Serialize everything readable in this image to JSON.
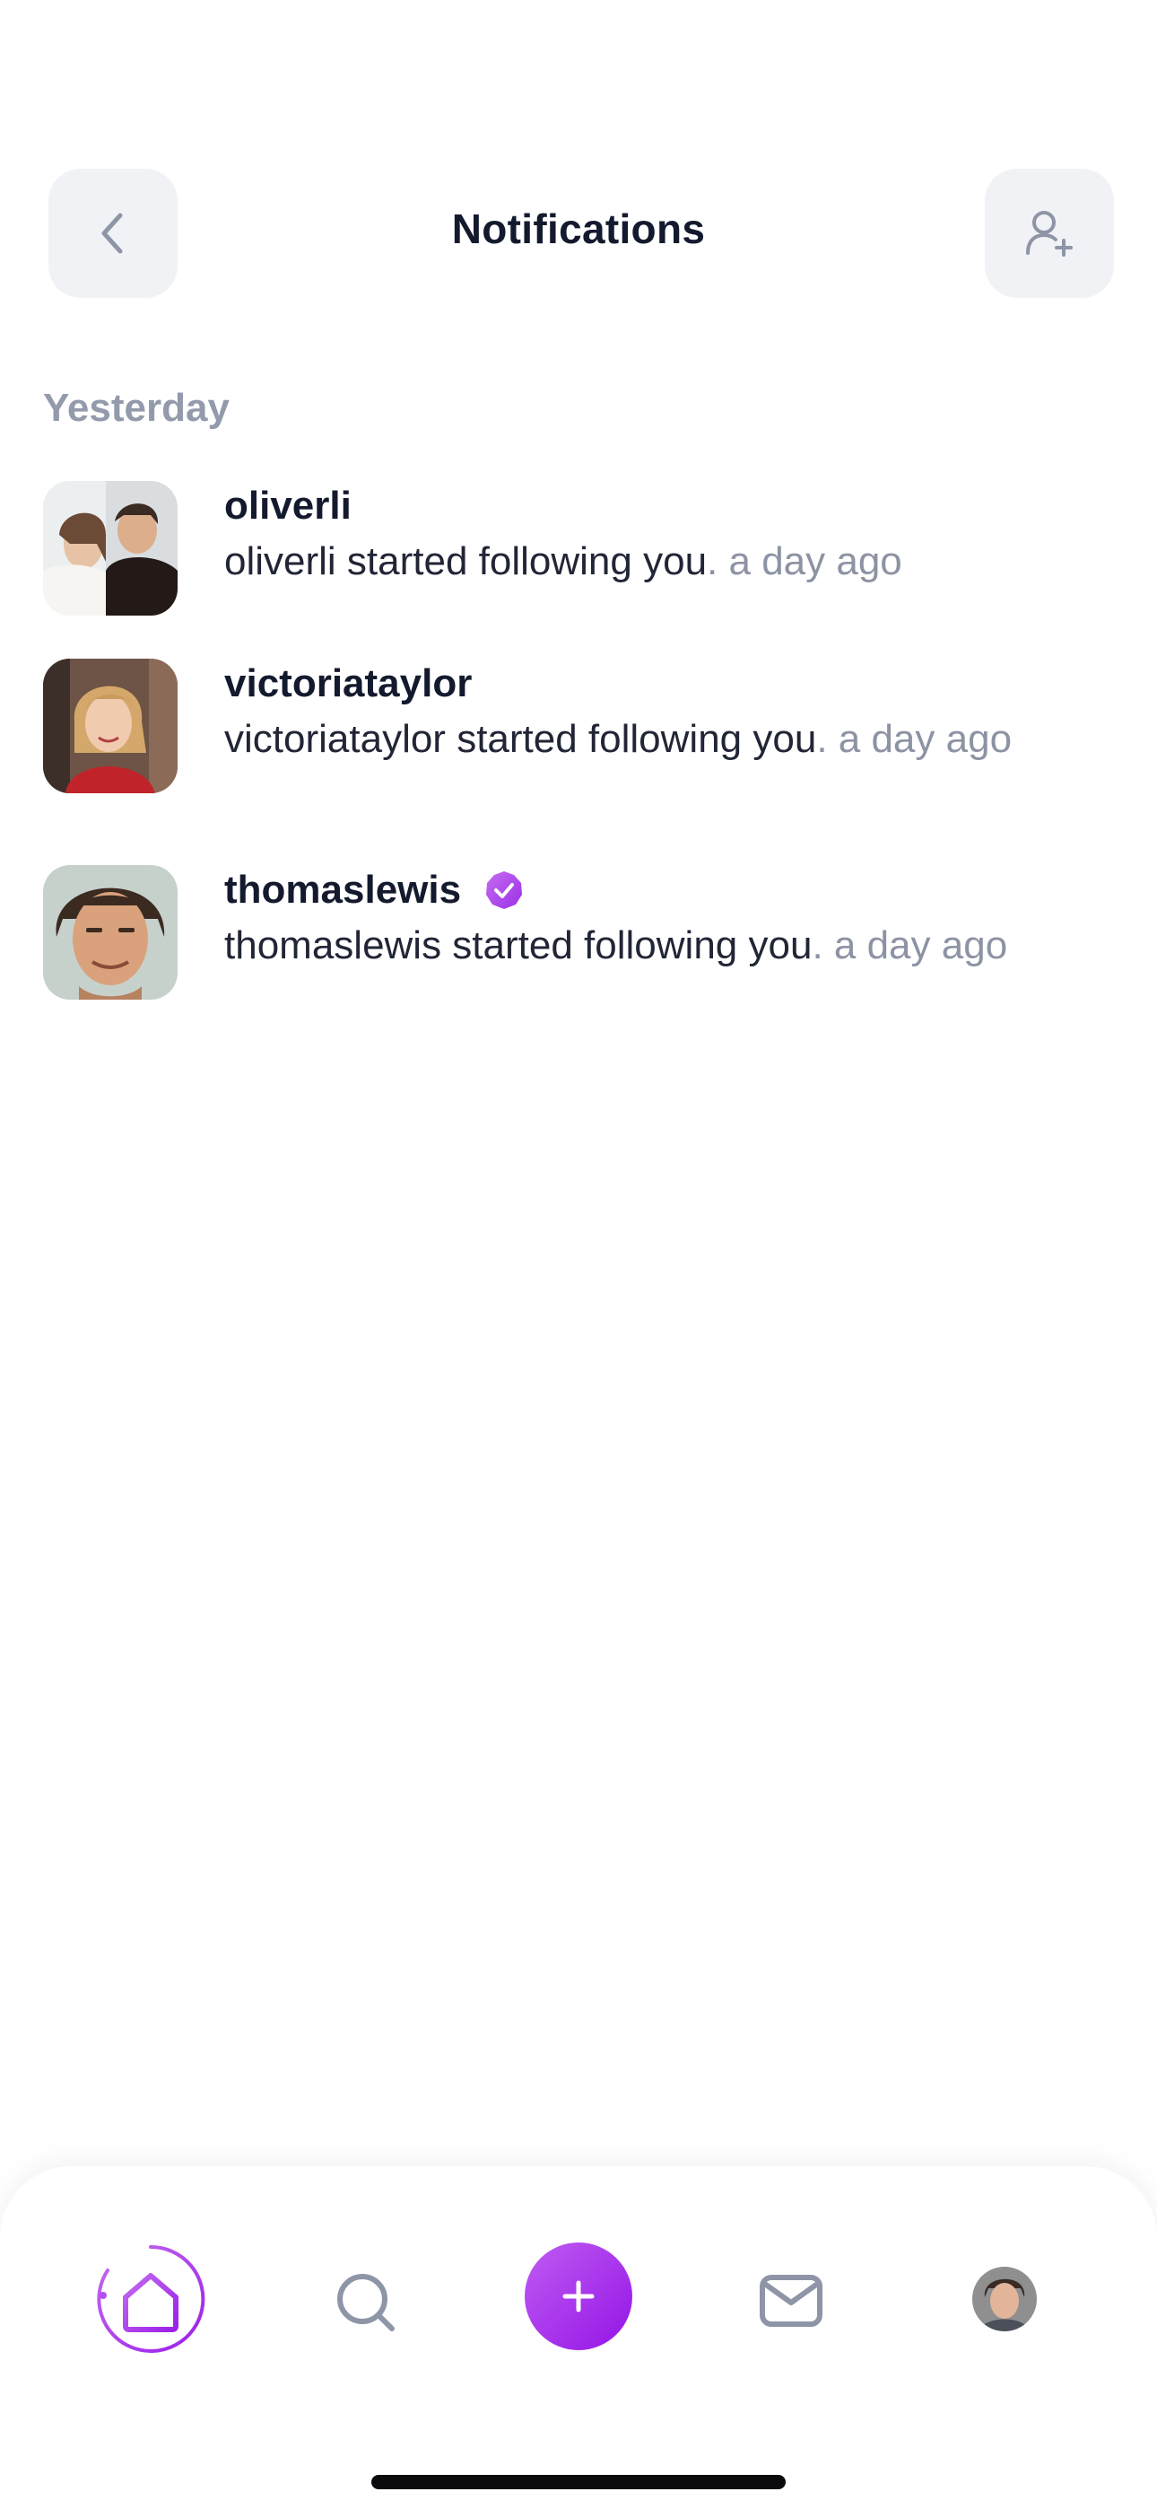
{
  "header": {
    "title": "Notifications",
    "back_icon": "chevron-left-icon",
    "add_user_icon": "user-plus-icon"
  },
  "section": {
    "label": "Yesterday"
  },
  "notifications": [
    {
      "username": "oliverli",
      "message": "oliverli started following you",
      "time": ". a day ago",
      "verified": false
    },
    {
      "username": "victoriataylor",
      "message": "victoriataylor started following you",
      "time": ". a day ago",
      "verified": false
    },
    {
      "username": "thomaslewis",
      "message": "thomaslewis started following you",
      "time": ". a day ago",
      "verified": true
    }
  ],
  "tabbar": {
    "items": [
      "home-icon",
      "search-icon",
      "plus-icon",
      "mail-icon",
      "profile-avatar"
    ],
    "active": "home-icon"
  },
  "colors": {
    "accent": "#a020f0",
    "accent_light": "#c56cf0",
    "text_primary": "#141a2e",
    "text_secondary": "#8c93a3",
    "section_label": "#929aab",
    "button_bg": "#f1f2f5"
  }
}
